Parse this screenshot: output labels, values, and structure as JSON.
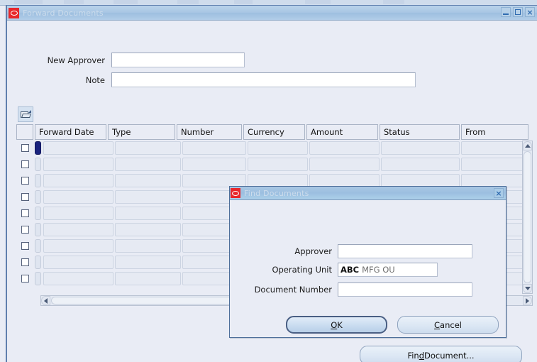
{
  "window": {
    "title": "Forward Documents",
    "logo_icon": "oracle-logo-icon",
    "controls": {
      "minimize": "minimize-icon",
      "maximize": "maximize-icon",
      "close": "×"
    }
  },
  "form": {
    "new_approver": {
      "label": "New Approver",
      "value": "",
      "placeholder": ""
    },
    "note": {
      "label": "Note",
      "value": "",
      "placeholder": ""
    }
  },
  "grid_toolbar": {
    "open_folder_icon": "folder-open-icon"
  },
  "grid": {
    "columns": [
      "Forward Date",
      "Type",
      "Number",
      "Currency",
      "Amount",
      "Status",
      "From"
    ],
    "rows": [
      {
        "selected": false,
        "current": true,
        "cells": [
          "",
          "",
          "",
          "",
          "",
          "",
          ""
        ]
      },
      {
        "selected": false,
        "current": false,
        "cells": [
          "",
          "",
          "",
          "",
          "",
          "",
          ""
        ]
      },
      {
        "selected": false,
        "current": false,
        "cells": [
          "",
          "",
          "",
          "",
          "",
          "",
          ""
        ]
      },
      {
        "selected": false,
        "current": false,
        "cells": [
          "",
          "",
          "",
          "",
          "",
          "",
          ""
        ]
      },
      {
        "selected": false,
        "current": false,
        "cells": [
          "",
          "",
          "",
          "",
          "",
          "",
          ""
        ]
      },
      {
        "selected": false,
        "current": false,
        "cells": [
          "",
          "",
          "",
          "",
          "",
          "",
          ""
        ]
      },
      {
        "selected": false,
        "current": false,
        "cells": [
          "",
          "",
          "",
          "",
          "",
          "",
          ""
        ]
      },
      {
        "selected": false,
        "current": false,
        "cells": [
          "",
          "",
          "",
          "",
          "",
          "",
          ""
        ]
      },
      {
        "selected": false,
        "current": false,
        "cells": [
          "",
          "",
          "",
          "",
          "",
          "",
          ""
        ]
      }
    ]
  },
  "scrollbars": {
    "vertical": {
      "up_icon": "scroll-up-arrow-icon",
      "down_icon": "scroll-down-arrow-icon"
    },
    "horizontal": {
      "left_icon": "scroll-left-arrow-icon",
      "right_icon": "scroll-right-arrow-icon"
    }
  },
  "actions": {
    "find_document": {
      "label_pre": "Fin",
      "label_mnemonic": "d",
      "label_post": " Document..."
    }
  },
  "dialog": {
    "title": "Find Documents",
    "logo_icon": "oracle-logo-icon",
    "close_label": "×",
    "fields": {
      "approver": {
        "label": "Approver",
        "value": "",
        "placeholder": ""
      },
      "operating_unit": {
        "label": "Operating Unit",
        "typed": "ABC",
        "suggestion": "MFG OU"
      },
      "document_number": {
        "label": "Document Number",
        "value": "",
        "placeholder": ""
      }
    },
    "buttons": {
      "ok": {
        "mnemonic": "O",
        "rest": "K"
      },
      "cancel": {
        "mnemonic": "C",
        "rest": "ancel"
      }
    }
  },
  "colors": {
    "background": "#e9ecf5",
    "titlebar": "#a9c7e4",
    "oracle_red": "#e8272b",
    "current_record": "#1a237e",
    "accent_border": "#4e6f9a"
  }
}
